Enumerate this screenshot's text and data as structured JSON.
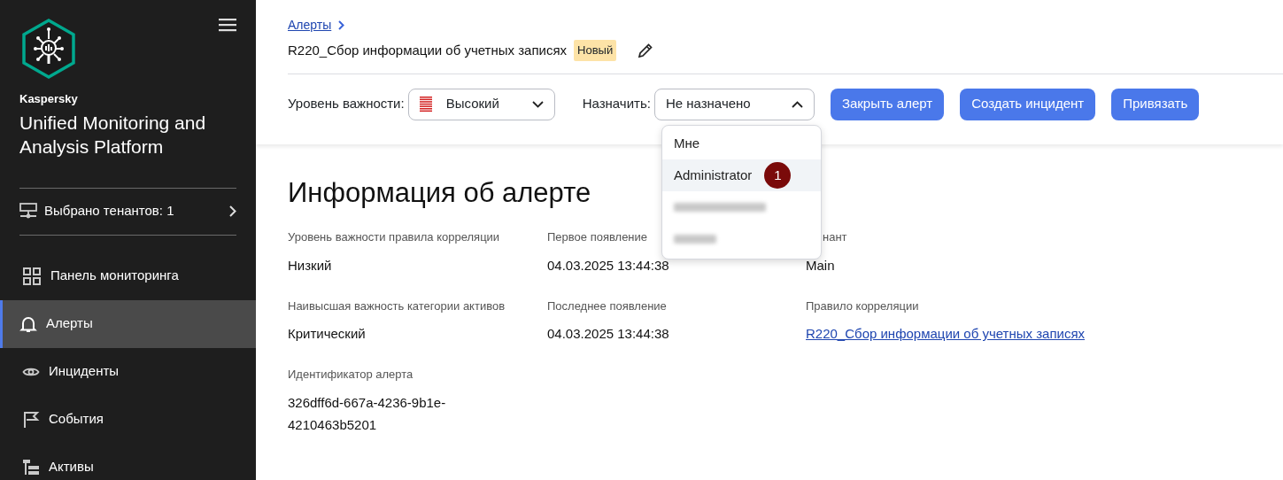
{
  "sidebar": {
    "brand": "Kaspersky",
    "product": "Unified Monitoring and Analysis Platform",
    "tenants": "Выбрано тенантов: 1",
    "items": [
      {
        "label": "Панель мониторинга",
        "selected": false
      },
      {
        "label": "Алерты",
        "selected": true
      },
      {
        "label": "Инциденты",
        "selected": false
      },
      {
        "label": "События",
        "selected": false
      },
      {
        "label": "Активы",
        "selected": false
      }
    ]
  },
  "breadcrumb": [
    {
      "label": "Алерты"
    }
  ],
  "title": "R220_Сбор информации об учетных записях",
  "status_badge": "Новый",
  "toolbar": {
    "severity_label": "Уровень важности:",
    "severity": "Высокий",
    "assign_label": "Назначить:",
    "assignee": "Не назначено",
    "assign_expanded": true,
    "buttons": [
      "Закрыть алерт",
      "Создать инцидент",
      "Привязать"
    ]
  },
  "assign_menu": [
    {
      "kind": "text",
      "label": "Мне",
      "selected": false
    },
    {
      "kind": "text",
      "label": "Administrator",
      "selected": true,
      "marker": "1"
    },
    {
      "kind": "redacted",
      "selected": false
    },
    {
      "kind": "redacted",
      "selected": false
    }
  ],
  "heading": "Информация об алерте",
  "fields": [
    {
      "kind": "text",
      "label": "Уровень важности правила корреляции",
      "value": "Низкий"
    },
    {
      "kind": "text",
      "label": "Первое появление",
      "value": "04.03.2025 13:44:38"
    },
    {
      "kind": "text",
      "label": "нант",
      "value": "Main",
      "covered": true
    },
    {
      "kind": "text",
      "label": "Наивысшая важность категории активов",
      "value": "Критический"
    },
    {
      "kind": "text",
      "label": "Последнее появление",
      "value": "04.03.2025 13:44:38"
    },
    {
      "kind": "link",
      "label": "Правило корреляции",
      "value": "R220_Сбор информации об учетных записях"
    },
    {
      "kind": "text",
      "label": "Идентификатор алерта",
      "value": "326dff6d-667a-4236-9b1e-4210463b5201"
    }
  ]
}
